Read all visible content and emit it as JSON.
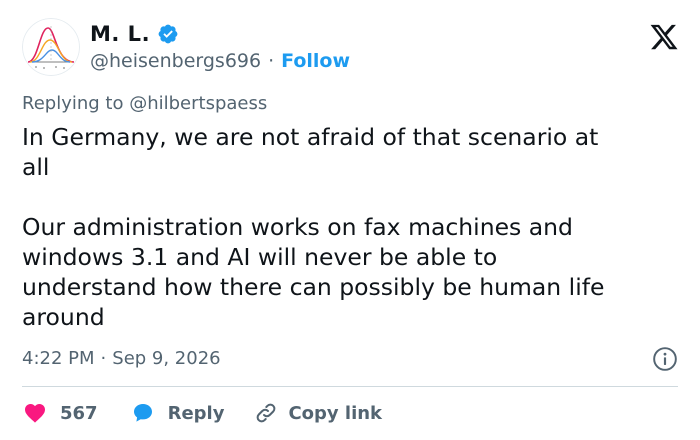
{
  "author": {
    "display_name": "M. L.",
    "handle": "@heisenbergs696",
    "separator": "·",
    "follow_label": "Follow"
  },
  "reply": {
    "prefix": "Replying to",
    "to_handle": "@hilbertspaess"
  },
  "tweet": {
    "text": "In Germany, we are not afraid of that scenario at\nall\n\nOur administration works on fax machines and\nwindows 3.1 and AI will never be able to\nunderstand how there can possibly be human life\naround"
  },
  "meta": {
    "time": "4:22 PM",
    "separator": "·",
    "date": "Sep 9, 2026"
  },
  "actions": {
    "like_count": "567",
    "reply_label": "Reply",
    "copy_link_label": "Copy link"
  },
  "colors": {
    "accent": "#1d9bf0",
    "like": "#f91880",
    "text": "#0f1419",
    "muted": "#536471"
  },
  "icons": {
    "verified": "verified-badge-icon",
    "logo": "x-logo-icon",
    "info": "info-icon",
    "like": "heart-icon",
    "reply": "speech-bubble-icon",
    "copy": "link-icon"
  }
}
